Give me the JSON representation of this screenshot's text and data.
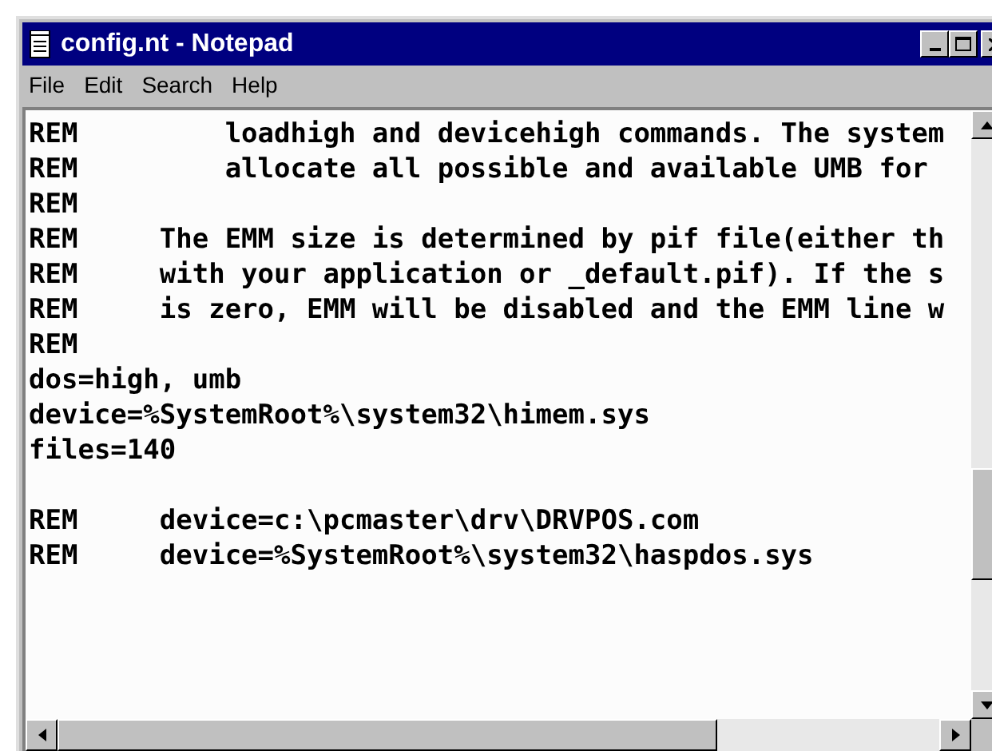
{
  "window": {
    "title": "config.nt - Notepad"
  },
  "menu": [
    "File",
    "Edit",
    "Search",
    "Help"
  ],
  "lines": [
    "REM         loadhigh and devicehigh commands. The system",
    "REM         allocate all possible and available UMB for",
    "REM",
    "REM     The EMM size is determined by pif file(either th",
    "REM     with your application or _default.pif). If the s",
    "REM     is zero, EMM will be disabled and the EMM line w",
    "REM",
    "dos=high, umb",
    "device=%SystemRoot%\\system32\\himem.sys",
    "files=140",
    {
      "kind": "blank"
    },
    "REM     device=c:\\pcmaster\\drv\\DRVPOS.com",
    "REM     device=%SystemRoot%\\system32\\haspdos.sys"
  ]
}
